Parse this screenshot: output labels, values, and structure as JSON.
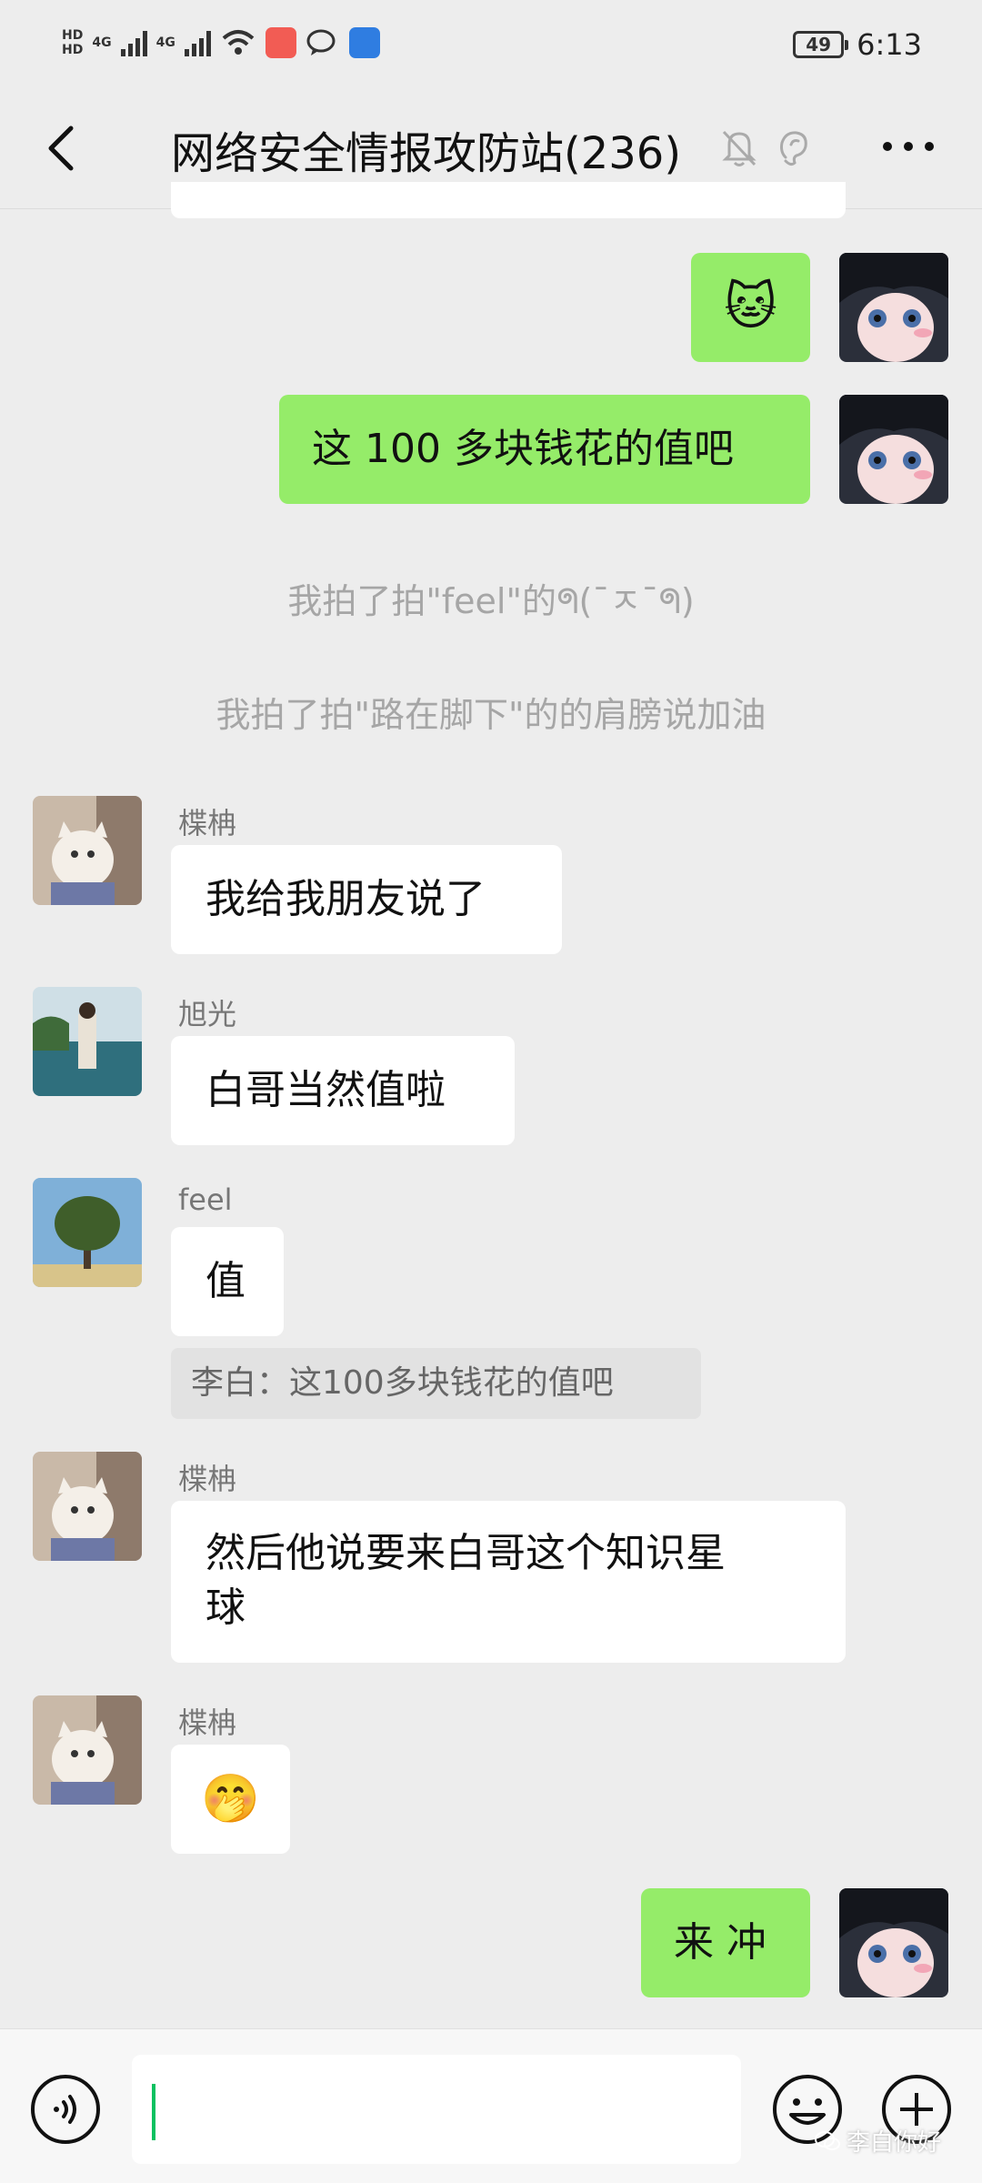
{
  "status_bar": {
    "hd1": "HD",
    "hd2": "HD",
    "net1": "4G",
    "net2": "4G",
    "wifi_label": "6",
    "battery": "49",
    "time": "6:13"
  },
  "header": {
    "title": "网络安全情报攻防站(236)"
  },
  "messages": {
    "cut_off": "",
    "m1": {
      "emoji": "🐱"
    },
    "m2": {
      "text": "这 100 多块钱花的值吧"
    },
    "sys1": "我拍了拍\"feel\"的ᖗ(¯ㅈ¯ᖗ)",
    "sys2": "我拍了拍\"路在脚下\"的的肩膀说加油",
    "m3": {
      "nick": "楪柟",
      "text": "我给我朋友说了"
    },
    "m4": {
      "nick": "旭光",
      "text": "白哥当然值啦"
    },
    "m5": {
      "nick": "feel",
      "text": "值",
      "quote": "李白：这100多块钱花的值吧"
    },
    "m6": {
      "nick": "楪柟",
      "text_line1": "然后他说要来白哥这个知识星",
      "text_line2": "球"
    },
    "m7": {
      "nick": "楪柟",
      "emoji": "🤭"
    },
    "m8": {
      "text": "来 冲"
    }
  },
  "input": {
    "value": ""
  },
  "watermark": "李白你好"
}
